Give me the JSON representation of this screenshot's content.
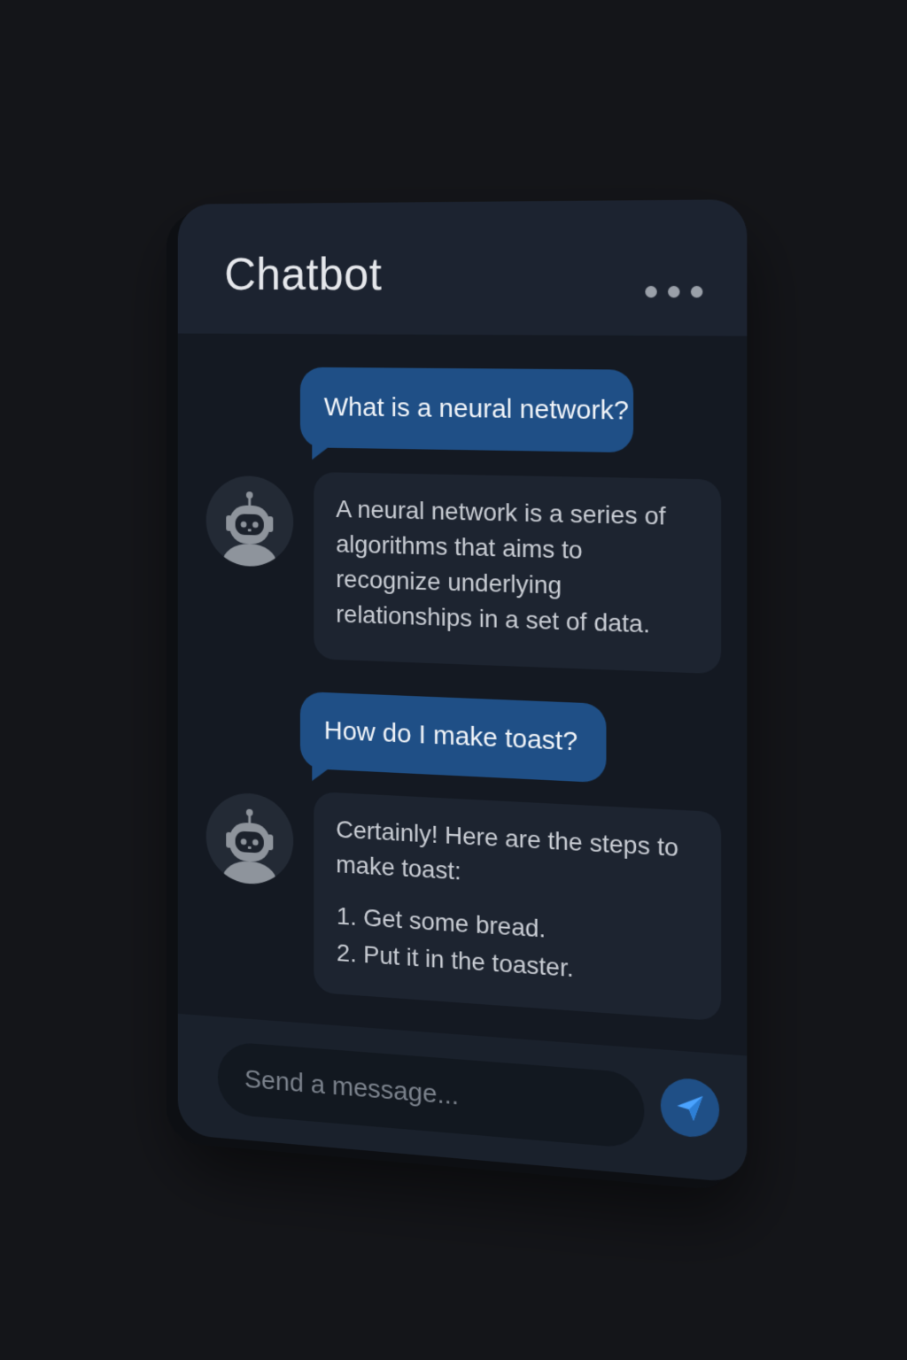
{
  "header": {
    "title": "Chatbot",
    "menu_icon": "more-horizontal-icon"
  },
  "messages": [
    {
      "role": "user",
      "text": "What is a neural network?"
    },
    {
      "role": "bot",
      "avatar_icon": "robot-icon",
      "text": "A neural network is a series of algorithms that aims to recognize underlying relationships in a set of data."
    },
    {
      "role": "user",
      "text": "How do I make toast?"
    },
    {
      "role": "bot",
      "avatar_icon": "robot-icon",
      "text": "Certainly! Here are the steps to make toast:",
      "steps": [
        "Get some bread.",
        "Put it in the toaster."
      ]
    }
  ],
  "composer": {
    "placeholder": "Send a message...",
    "send_icon": "send-icon"
  },
  "colors": {
    "background": "#141519",
    "window": "#171c24",
    "user_bubble": "#1f4f86",
    "bot_bubble": "#1d2430",
    "accent": "#4aa3ff"
  }
}
